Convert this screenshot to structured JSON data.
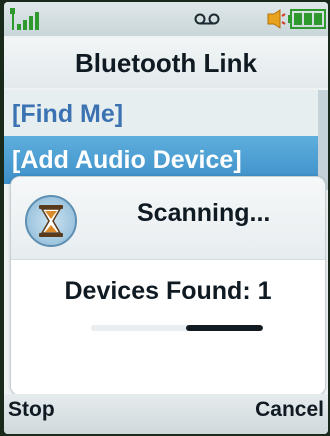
{
  "status_bar": {
    "signal_icon": "signal-strength-icon",
    "voicemail_icon": "voicemail-icon",
    "ringer_icon": "ringer-icon",
    "battery_icon": "battery-icon"
  },
  "title": "Bluetooth Link",
  "menu": [
    {
      "label": "[Find Me]"
    },
    {
      "label": "[Add Audio Device]",
      "selected": true
    }
  ],
  "dialog": {
    "status_icon": "hourglass-icon",
    "status_text": "Scanning...",
    "devices_found": "Devices Found: 1",
    "progress": 0.45
  },
  "softkeys": {
    "left": "Stop",
    "right": "Cancel"
  },
  "colors": {
    "selection": "#3d8fc8",
    "menu_text": "#3b73b2",
    "signal": "#2e9a2e",
    "battery": "#2e9a2e"
  }
}
